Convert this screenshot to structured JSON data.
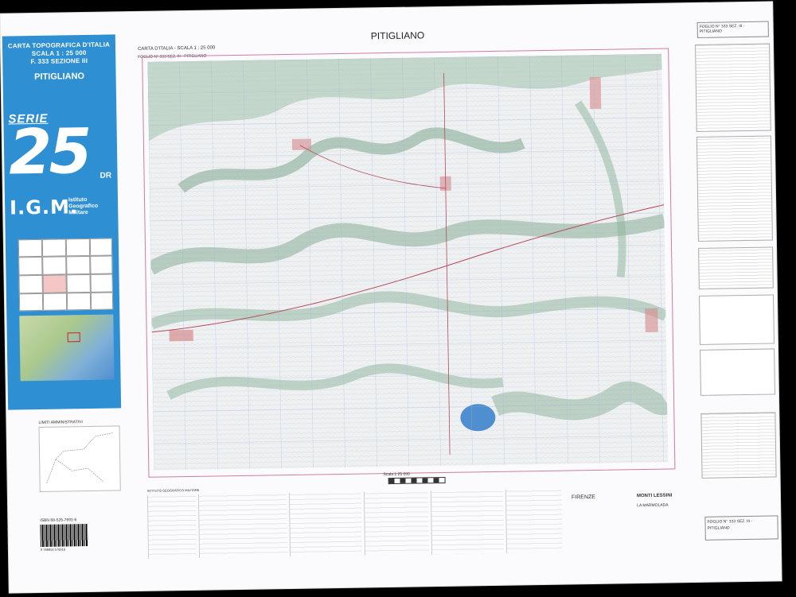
{
  "cover": {
    "heading": [
      "CARTA TOPOGRAFICA D'ITALIA",
      "SCALA 1 : 25 000",
      "F. 333 SEZIONE III"
    ],
    "sheet_name": "PITIGLIANO",
    "serie_label": "SERIE",
    "serie_number": "25",
    "serie_suffix": "DR",
    "institute_abbr": "I.G.M.",
    "institute_name": [
      "Istituto",
      "Geografico",
      "Militare"
    ]
  },
  "left_panel": {
    "limiti_title": "LIMITI AMMINISTRATIVI",
    "isbn": "ISBN 88-525-7691-6",
    "barcode_digits": "9 788852 576916"
  },
  "map": {
    "title": "PITIGLIANO",
    "header_note": "CARTA D'ITALIA - SCALA 1 : 25 000",
    "sheet_ref": "FOGLIO N° 333 SEZ. III - PITIGLIANO",
    "scale_label": "Scala 1:25 000"
  },
  "right_panel": {
    "header": "FOGLIO N° 333 SEZ. III - PITIGLIANO",
    "footer_title": "FOGLIO N° 333 SEZ. III - PITIGLIANO"
  },
  "legend": {
    "institute": "ISTITUTO GEOGRAFICO MILITARE",
    "towns": [
      "FIRENZE",
      "MONTI LESSINI",
      "LA MARMOLADA"
    ]
  },
  "colors": {
    "cover_blue": "#2e8fd3",
    "frame_pink": "#d07aa0",
    "relief_green": "#8bb39a",
    "lake_blue": "#4f8fd0"
  }
}
